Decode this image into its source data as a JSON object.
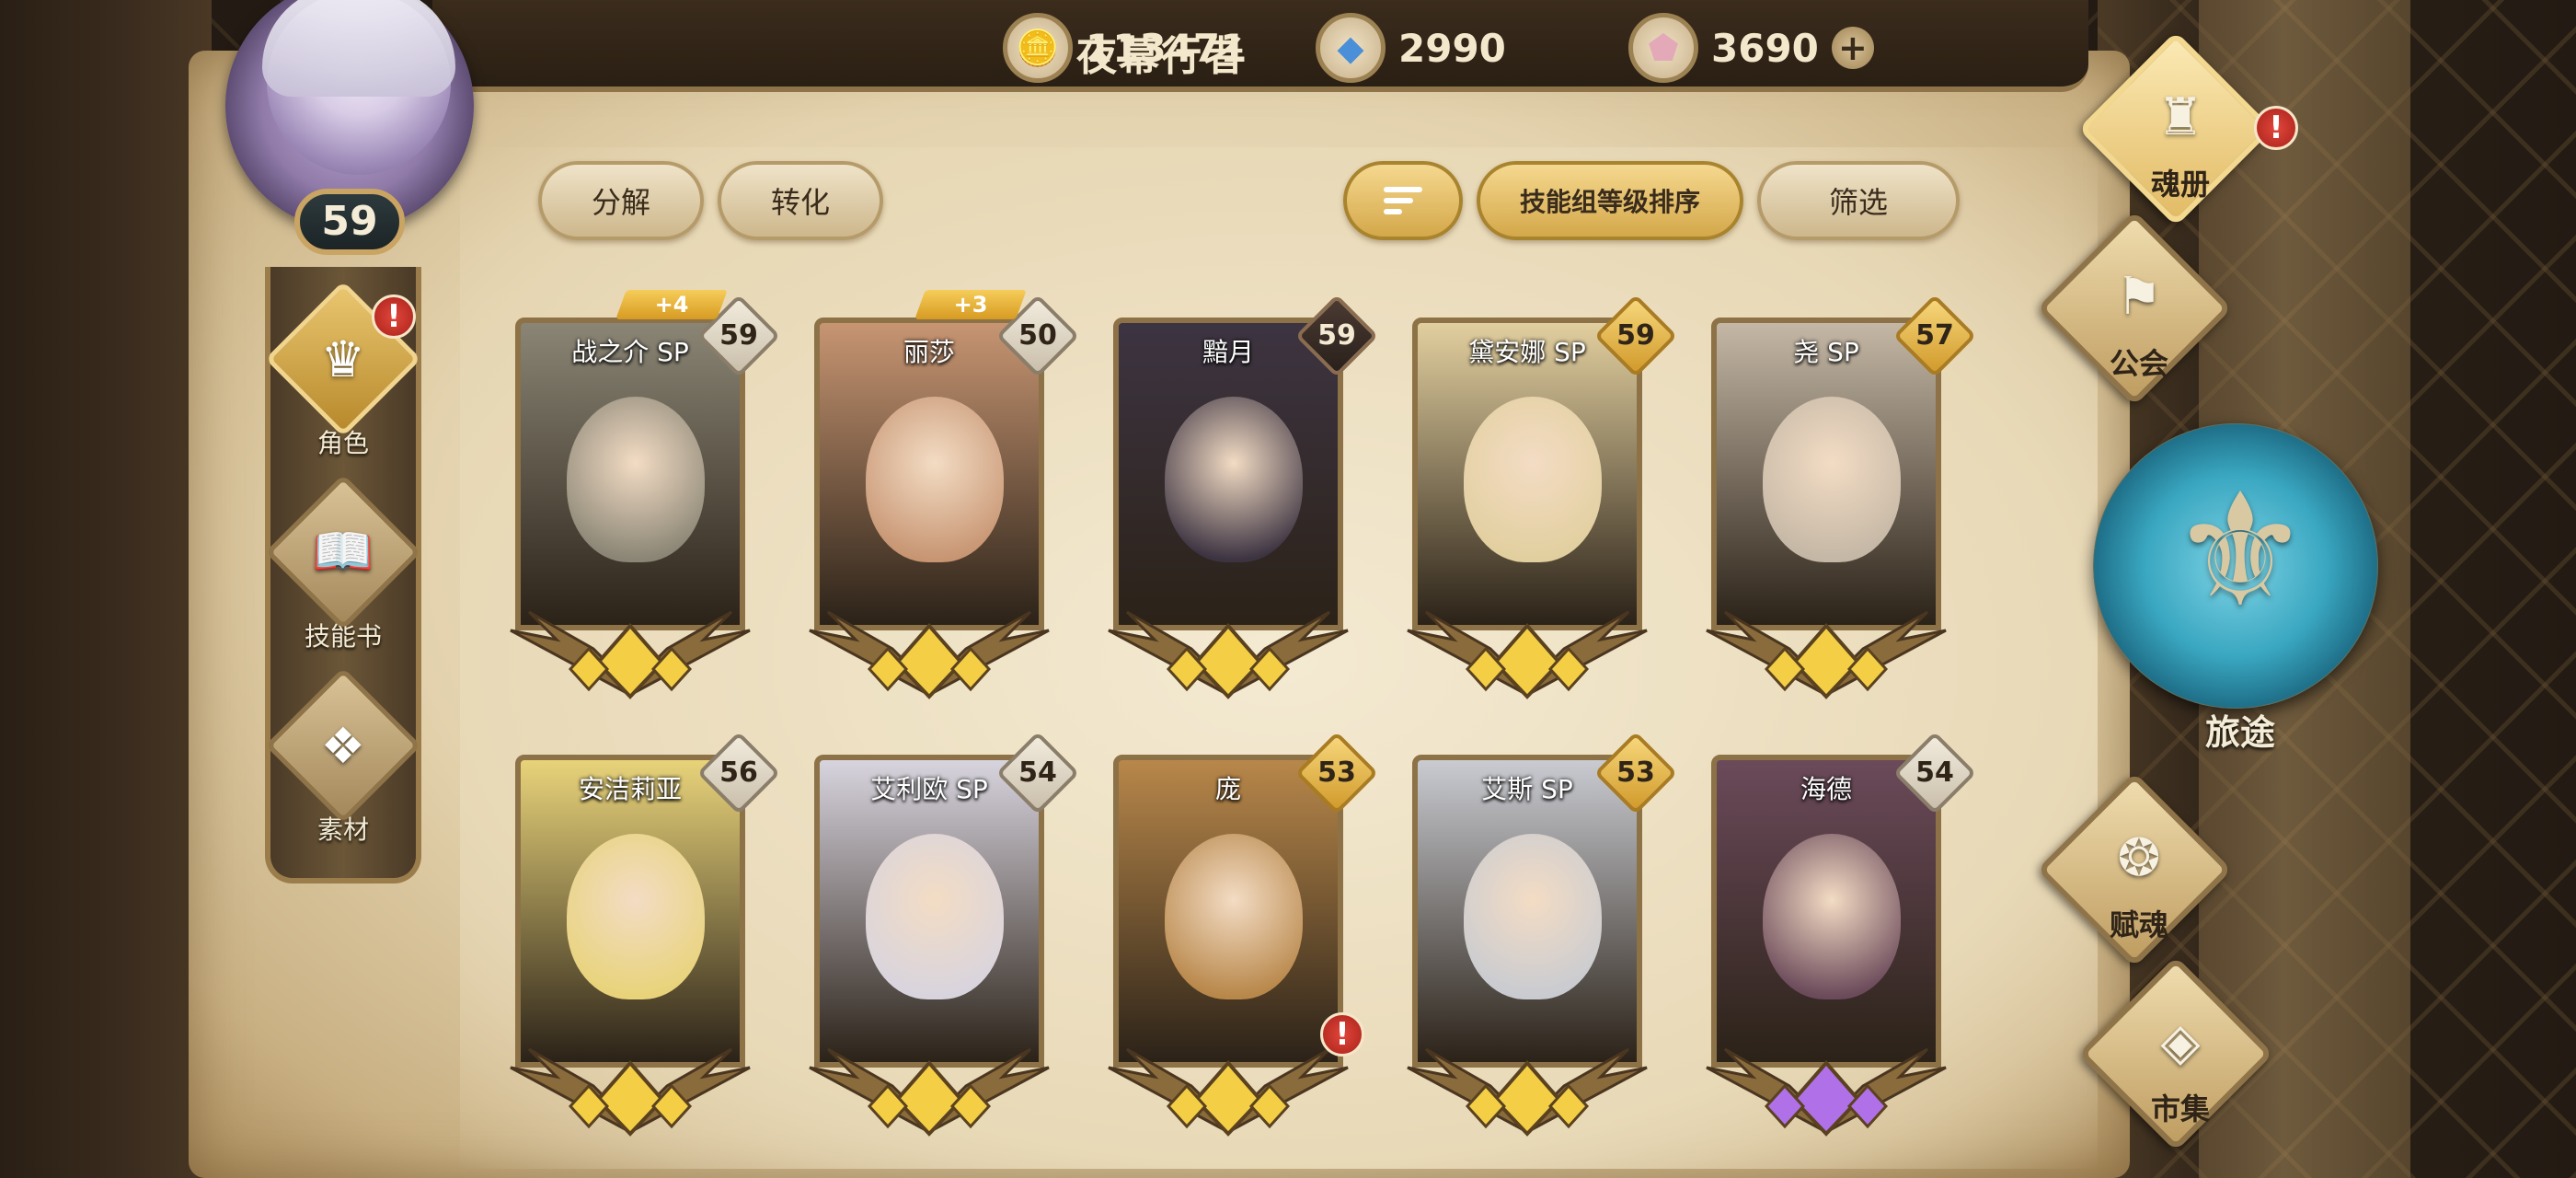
{
  "player": {
    "name": "夜幕行者",
    "level": "59"
  },
  "currencies": {
    "gold": {
      "icon": "gold-coin-icon",
      "value": "113471"
    },
    "crystal": {
      "icon": "blue-crystal-icon",
      "value": "2990"
    },
    "gem": {
      "icon": "pink-gem-icon",
      "value": "3690",
      "plus": "+"
    }
  },
  "left_nav": [
    {
      "label": "角色",
      "icon": "character-icon",
      "active": true,
      "alert": "!"
    },
    {
      "label": "技能书",
      "icon": "skill-book-icon",
      "active": false
    },
    {
      "label": "素材",
      "icon": "material-icon",
      "active": false
    }
  ],
  "actions": {
    "decompose": "分解",
    "convert": "转化",
    "sort_mode": "技能组等级排序",
    "filter": "筛选"
  },
  "cards": [
    {
      "name": "战之介 SP",
      "level": "59",
      "badge": "silver",
      "plus": "+4",
      "tone": "#8a8575"
    },
    {
      "name": "丽莎",
      "level": "50",
      "badge": "silver",
      "plus": "+3",
      "tone": "#c79572"
    },
    {
      "name": "黯月",
      "level": "59",
      "badge": "dark",
      "plus": "",
      "tone": "#3d3442"
    },
    {
      "name": "黛安娜 SP",
      "level": "59",
      "badge": "gold",
      "plus": "",
      "tone": "#e2cf9f"
    },
    {
      "name": "尧 SP",
      "level": "57",
      "badge": "gold",
      "plus": "",
      "tone": "#c4b7a5"
    },
    {
      "name": "安洁莉亚",
      "level": "56",
      "badge": "silver",
      "plus": "",
      "tone": "#e8d37a"
    },
    {
      "name": "艾利欧 SP",
      "level": "54",
      "badge": "silver",
      "plus": "",
      "tone": "#d8d4de"
    },
    {
      "name": "庞",
      "level": "53",
      "badge": "gold",
      "plus": "",
      "tone": "#b8874a",
      "alert": "!"
    },
    {
      "name": "艾斯 SP",
      "level": "53",
      "badge": "gold",
      "plus": "",
      "tone": "#c9cbd1"
    },
    {
      "name": "海德",
      "level": "54",
      "badge": "silver",
      "plus": "",
      "tone": "#6b4a5a"
    }
  ],
  "right_nav": {
    "soulbook": {
      "label": "魂册",
      "icon": "soulbook-icon",
      "alert": "!"
    },
    "guild": {
      "label": "公会",
      "icon": "guild-banner-icon"
    },
    "journey": {
      "label": "旅途",
      "icon": "journey-emblem-icon"
    },
    "empower": {
      "label": "赋魂",
      "icon": "swirl-icon"
    },
    "market": {
      "label": "市集",
      "icon": "diamond-gem-icon"
    }
  },
  "colors": {
    "accent_gold": "#d4a84a",
    "parchment": "#e8d9b7",
    "frame_brown": "#8e7448",
    "alert_red": "#c9362c",
    "journey_blue": "#3aa7c1"
  }
}
